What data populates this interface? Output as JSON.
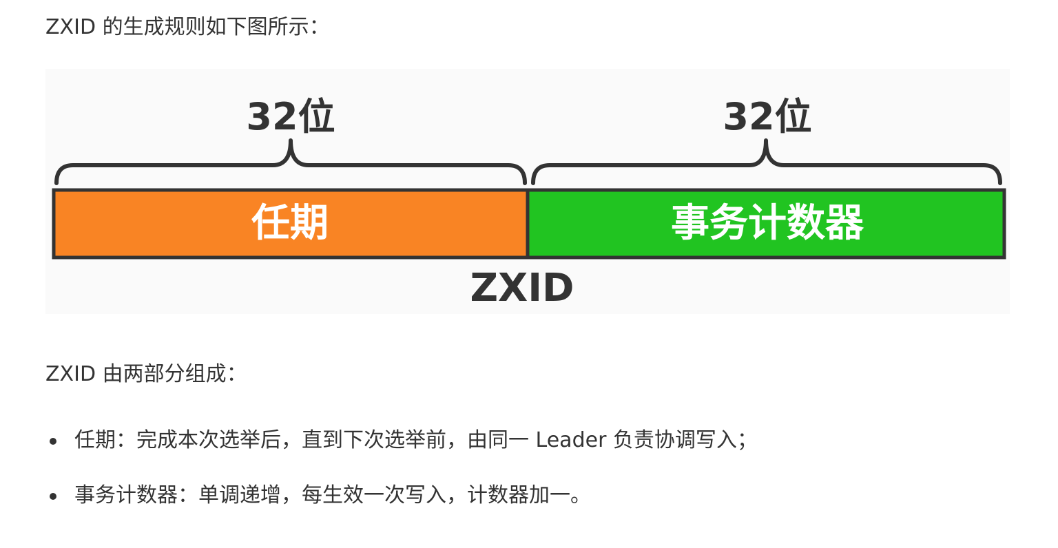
{
  "intro": "ZXID 的生成规则如下图所示：",
  "figure": {
    "left_bits": "32位",
    "right_bits": "32位",
    "left_segment": "任期",
    "right_segment": "事务计数器",
    "caption": "ZXID",
    "colors": {
      "left_segment": "#f98424",
      "right_segment": "#21c421",
      "outline": "#333333"
    }
  },
  "composition": "ZXID 由两部分组成：",
  "bullets": [
    "任期：完成本次选举后，直到下次选举前，由同一 Leader 负责协调写入；",
    "事务计数器：单调递增，每生效一次写入，计数器加一。"
  ]
}
